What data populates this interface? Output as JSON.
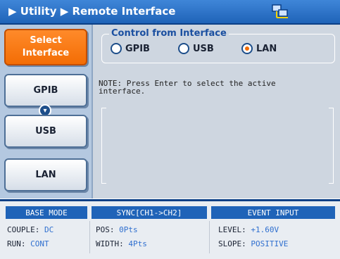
{
  "title_bar": {
    "breadcrumb": "▶ Utility ▶ Remote Interface",
    "status_icon": "network-icon"
  },
  "softkeys": {
    "select_interface": "Select\nInterface",
    "gpib": "GPIB",
    "usb": "USB",
    "lan": "LAN",
    "more_icon": "chevron-down-icon"
  },
  "control": {
    "legend": "Control from Interface",
    "options": [
      {
        "label": "GPIB",
        "selected": false
      },
      {
        "label": "USB",
        "selected": false
      },
      {
        "label": "LAN",
        "selected": true
      }
    ]
  },
  "note": "NOTE: Press Enter to select the active\ninterface.",
  "status": {
    "base_mode": {
      "header": "BASE MODE",
      "couple_label": "COUPLE:",
      "couple_value": "DC",
      "run_label": "RUN:",
      "run_value": "CONT"
    },
    "sync": {
      "header": "SYNC[CH1->CH2]",
      "pos_label": "POS:",
      "pos_value": "0Pts",
      "width_label": "WIDTH:",
      "width_value": "4Pts"
    },
    "event": {
      "header": "EVENT INPUT",
      "level_label": "LEVEL:",
      "level_value": "+1.60V",
      "slope_label": "SLOPE:",
      "slope_value": "POSITIVE"
    }
  },
  "colors": {
    "title_bg": "#1f63b8",
    "active_softkey": "#f36d05",
    "value_text": "#2f6fcf"
  }
}
